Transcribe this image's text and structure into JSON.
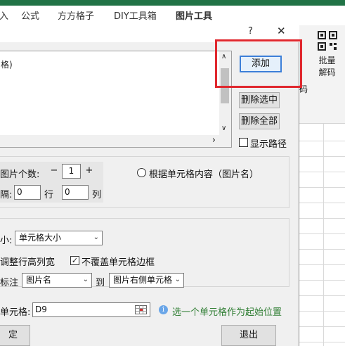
{
  "ribbon": {
    "tabs": [
      "插入",
      "公式",
      "方方格子",
      "DIY工具箱",
      "图片工具"
    ],
    "qr_group_label_line1": "批量",
    "qr_group_label_line2": "解码",
    "group_caption": "码"
  },
  "dialog": {
    "title_help": "?",
    "title_close": "✕",
    "list_items": [
      "格)"
    ],
    "scroll_up": "∧",
    "scroll_down": "∨",
    "scroll_right": "›",
    "add_button": "添加",
    "delete_selected_button": "删除选中",
    "delete_all_button": "删除全部",
    "show_path_label": "显示路径",
    "picture_count_label": "图片个数:",
    "stepper_minus": "−",
    "stepper_value": "1",
    "stepper_plus": "+",
    "by_cell_content_label": "根据单元格内容（图片名）",
    "spacing_label": "隔:",
    "row_value": "0",
    "row_label": "行",
    "col_value": "0",
    "col_label": "列",
    "size_label": "小:",
    "size_select": "单元格大小",
    "adjust_label": "调整行高列宽",
    "no_cover_border_label": "不覆盖单元格边框",
    "annotate_label": "标注",
    "annotate_select": "图片名",
    "to_label": "到",
    "position_select": "图片右侧单元格",
    "cell_label": "单元格:",
    "cell_value": "D9",
    "hint_text": "选一个单元格作为起始位置",
    "ok_button": "定",
    "exit_button": "退出"
  },
  "colors": {
    "excel_green": "#217346",
    "highlight_red": "#e0282e",
    "hint_green": "#2e7d32"
  }
}
